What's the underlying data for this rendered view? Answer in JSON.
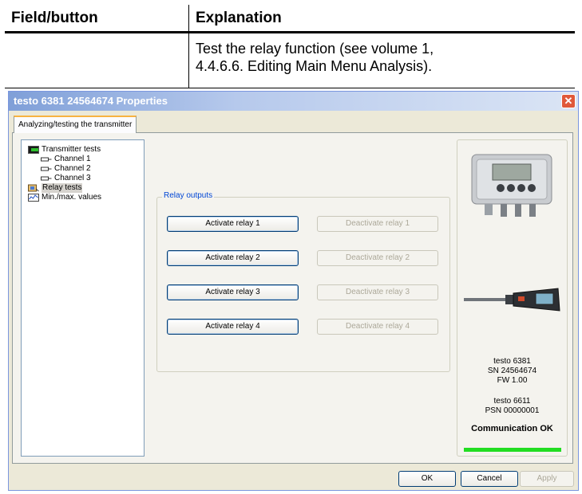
{
  "doc": {
    "header_field": "Field/button",
    "header_explanation": "Explanation",
    "row_explanation_line1": "Test the relay function (see volume 1,",
    "row_explanation_line2": "4.4.6.6. Editing Main Menu Analysis)."
  },
  "window": {
    "title": "testo 6381  24564674 Properties",
    "close_glyph": "✕"
  },
  "tab": {
    "label": "Analyzing/testing the transmitter"
  },
  "tree": {
    "items": [
      {
        "label": "Transmitter tests",
        "icon": "transmitter-icon",
        "level": 0
      },
      {
        "label": "Channel 1",
        "icon": "channel-icon",
        "level": 1
      },
      {
        "label": "Channel 2",
        "icon": "channel-icon",
        "level": 1
      },
      {
        "label": "Channel 3",
        "icon": "channel-icon",
        "level": 1
      },
      {
        "label": "Relay tests",
        "icon": "relay-icon",
        "level": 0,
        "selected": true
      },
      {
        "label": "Min./max. values",
        "icon": "minmax-chart-icon",
        "level": 0
      }
    ]
  },
  "relay_group": {
    "label": "Relay outputs",
    "activate": [
      "Activate relay 1",
      "Activate relay 2",
      "Activate relay 3",
      "Activate relay 4"
    ],
    "deactivate": [
      "Deactivate relay 1",
      "Deactivate relay 2",
      "Deactivate relay 3",
      "Deactivate relay 4"
    ]
  },
  "info": {
    "device": "testo 6381",
    "serial": "SN 24564674",
    "firmware": "FW  1.00",
    "probe": "testo 6611",
    "probe_serial": "PSN 00000001",
    "communication": "Communication OK"
  },
  "buttons": {
    "ok": "OK",
    "cancel": "Cancel",
    "apply": "Apply"
  },
  "colors": {
    "status_ok": "#22dd22",
    "tab_highlight": "#f7b341",
    "close": "#e0593a"
  }
}
